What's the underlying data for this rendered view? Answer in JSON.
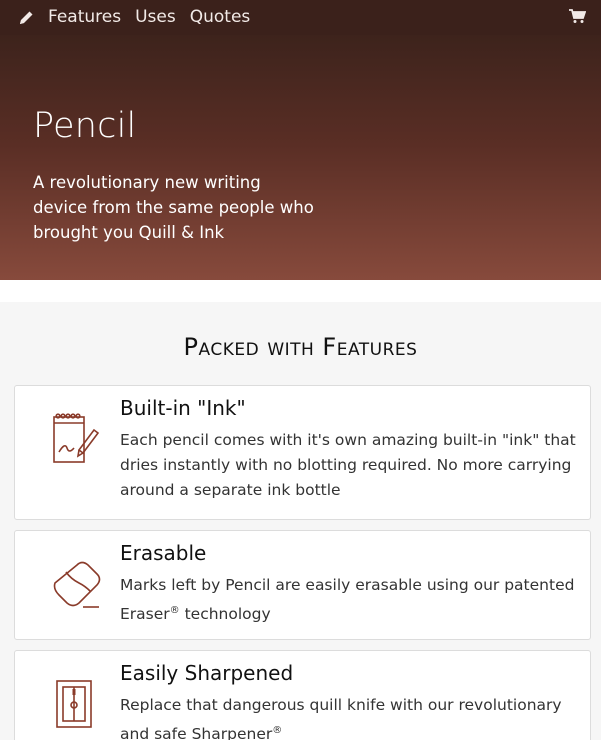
{
  "nav": {
    "links": [
      "Features",
      "Uses",
      "Quotes"
    ],
    "icons": {
      "brand": "pencil-icon",
      "cart": "cart-icon"
    }
  },
  "hero": {
    "title": "Pencil",
    "subtitle": "A revolutionary new writing device from the same people who brought you Quill & Ink"
  },
  "features": {
    "heading": "Packed with Features",
    "items": [
      {
        "title": "Built-in \"Ink\"",
        "desc": "Each pencil comes with it's own amazing built-in \"ink\" that dries instantly with no blotting required. No more carrying around a separate ink bottle",
        "icon": "notepad-pencil-icon"
      },
      {
        "title": "Erasable",
        "desc_text": "Marks left by Pencil are easily erasable using our patented Eraser",
        "desc_sup": "®",
        "desc_tail": " technology",
        "icon": "eraser-icon"
      },
      {
        "title": "Easily Sharpened",
        "desc_text": "Replace that dangerous quill knife with our revolutionary and safe Sharpener",
        "desc_sup": "®",
        "icon": "sharpener-icon"
      }
    ]
  },
  "colors": {
    "navbar": "#3b211b",
    "hero_top": "#3d231c",
    "hero_bottom": "#874a3c",
    "icon": "#8a3b2a"
  }
}
